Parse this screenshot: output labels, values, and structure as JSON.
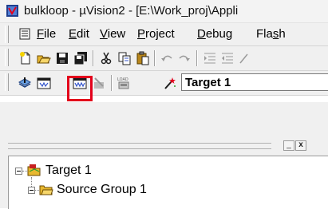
{
  "window": {
    "title": "bulkloop  - µVision2 - [E:\\Work_proj\\Appli",
    "icon": "uvision-app-icon"
  },
  "menu": {
    "items": [
      {
        "key": "F",
        "rest": "ile"
      },
      {
        "key": "E",
        "rest": "dit"
      },
      {
        "key": "V",
        "rest": "iew"
      },
      {
        "key": "P",
        "rest": "roject"
      },
      {
        "key": "D",
        "rest": "ebug"
      },
      {
        "key": "",
        "rest": "Fla",
        "key2": "s",
        "rest2": "h"
      }
    ]
  },
  "file_toolbar": {
    "icons": [
      "new-file-icon",
      "open-folder-icon",
      "save-icon",
      "save-all-icon",
      "cut-icon",
      "copy-icon",
      "paste-icon",
      "undo-icon",
      "redo-icon",
      "indent-icon",
      "outdent-icon"
    ]
  },
  "build_toolbar": {
    "icons": [
      "translate-icon",
      "build-target-icon",
      "rebuild-all-icon",
      "stop-build-icon",
      "download-icon",
      "options-wand-icon"
    ],
    "highlighted": "rebuild-all-icon",
    "load_label": "LOAD",
    "target_select": "Target 1"
  },
  "project_panel": {
    "header_buttons": [
      "_",
      "x"
    ],
    "tree": [
      {
        "label": "Target 1",
        "level": 0,
        "icon": "target-folder-icon"
      },
      {
        "label": "Source Group 1",
        "level": 1,
        "icon": "folder-icon"
      }
    ]
  },
  "colors": {
    "highlight": "#e3001b",
    "toolbar_bg": "#f0f0f0"
  }
}
